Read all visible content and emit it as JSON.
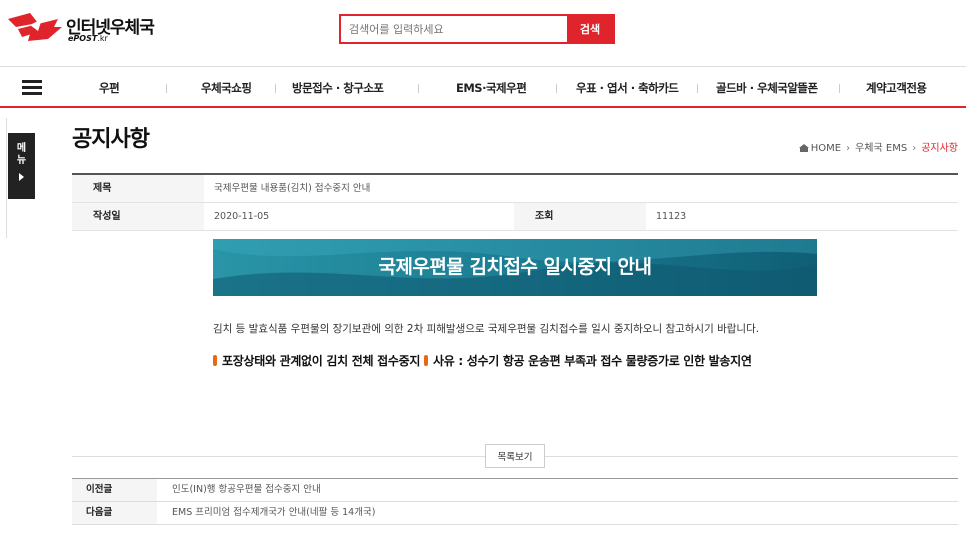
{
  "header": {
    "logo_text": "인터넷우체국",
    "logo_sub_bold": "ePOST",
    "logo_sub_rest": ".kr",
    "search_placeholder": "검색어를 입력하세요",
    "search_button": "검색"
  },
  "gnb": {
    "menu_icon": "hamburger-icon",
    "items": [
      {
        "label": "우편"
      },
      {
        "label": "우체국쇼핑"
      },
      {
        "label": "방문접수 · 창구소포"
      },
      {
        "label": "EMS·국제우편"
      },
      {
        "label": "우표 · 엽서 · 축하카드"
      },
      {
        "label": "골드바 · 우체국알뜰폰"
      },
      {
        "label": "계약고객전용"
      }
    ]
  },
  "side": {
    "label_1": "메",
    "label_2": "뉴"
  },
  "page": {
    "title": "공지사항",
    "breadcrumb": [
      "HOME",
      "우체국 EMS",
      "공지사항"
    ]
  },
  "post": {
    "subject_label": "제목",
    "subject": "국제우편물 내용품(김치) 접수중지 안내",
    "date_label": "작성일",
    "date": "2020-11-05",
    "views_label": "조회",
    "views": "11123",
    "banner_text": "국제우편물 김치접수 일시중지 안내",
    "paragraph": "김치 등 발효식품 우편물의 장기보관에 의한 2차 피해발생으로 국제우편물 김치접수를 일시 중지하오니 참고하시기 바랍니다.",
    "bold_1": "포장상태와 관계없이 김치 전체 접수중지",
    "bold_2": "사유 : 성수기 항공 운송편 부족과 접수 물량증가로 인한 발송지연",
    "accent_color": "#e0242b",
    "bullet_color": "#e76a12"
  },
  "list_button": "목록보기",
  "nav": {
    "prev_label": "이전글",
    "prev_title": "인도(IN)행 항공우편물 접수중지 안내",
    "next_label": "다음글",
    "next_title": "EMS 프리미엄 접수제개국가 안내(네팔 등 14개국)"
  }
}
